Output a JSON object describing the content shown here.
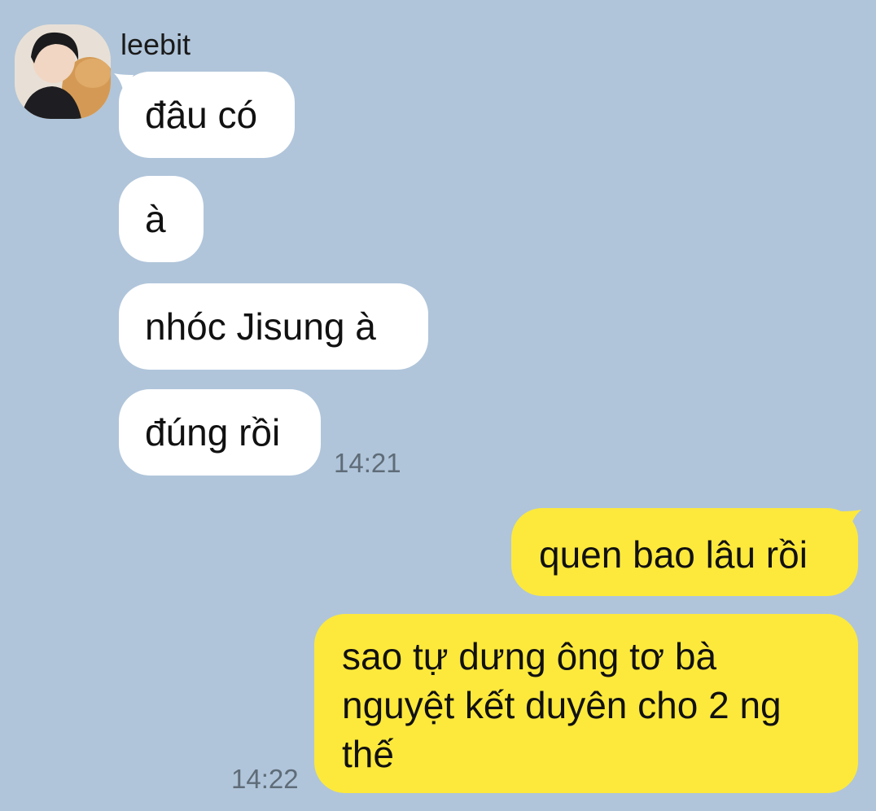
{
  "chat": {
    "contact_name": "leebit",
    "incoming": [
      {
        "text": "đâu có"
      },
      {
        "text": "à"
      },
      {
        "text": "nhóc Jisung à"
      },
      {
        "text": "đúng rồi"
      }
    ],
    "incoming_time": "14:21",
    "outgoing": [
      {
        "text": "quen bao lâu rồi"
      },
      {
        "line1": "sao tự dưng ông tơ bà",
        "line2": "nguyệt kết duyên cho 2 ng",
        "line3": "thế"
      }
    ],
    "outgoing_time": "14:22"
  },
  "colors": {
    "background": "#b0c5da",
    "incoming_bubble": "#ffffff",
    "outgoing_bubble": "#fde93c",
    "timestamp": "#5f6c78"
  },
  "icons": {
    "avatar": "profile-photo"
  }
}
